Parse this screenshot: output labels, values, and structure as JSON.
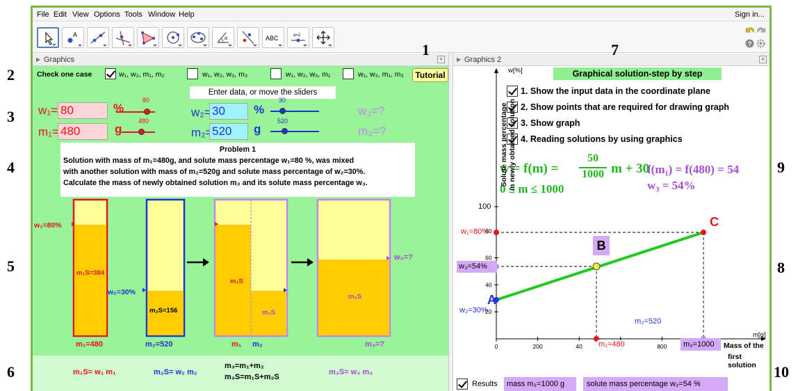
{
  "menu": [
    "File",
    "Edit",
    "View",
    "Options",
    "Tools",
    "Window",
    "Help"
  ],
  "sign_in": "Sign in...",
  "panels": {
    "graphics1": "Graphics",
    "graphics2": "Graphics 2"
  },
  "annotations": [
    "1",
    "2",
    "3",
    "4",
    "5",
    "6",
    "7",
    "8",
    "9",
    "10"
  ],
  "case_bar": {
    "label": "Check one case",
    "options": [
      "w₁, w₂, m₁, m₂",
      "w₁, w₂, w₃, m₃",
      "w₁, w₂, w₃, m₁",
      "w₁, w₃, m₁, m₃"
    ],
    "tutorial": "Tutorial"
  },
  "enter_data": "Enter data, or move the sliders",
  "inputs": {
    "w1_label": "w₁=",
    "w1_value": "80",
    "w1_unit": "%",
    "w1_slider": "80",
    "m1_label": "m₁=",
    "m1_value": "480",
    "m1_unit": "g",
    "m1_slider": "480",
    "w2_label": "w₂=",
    "w2_value": "30",
    "w2_unit": "%",
    "w2_slider": "30",
    "m2_label": "m₂=",
    "m2_value": "520",
    "m2_unit": "g",
    "m2_slider": "520",
    "w3_q": "w₃=?",
    "m3_q": "m₃=?"
  },
  "problem": {
    "title": "Problem 1",
    "line1": "Solution with mass of m₁=480g, and solute mass percentage w₁=80 %, was mixed",
    "line2": "with another solution with mass of m₂=520g and solute mass percentage of w₂=30%.",
    "line3": "Calculate the mass of newly obtained solution m₃ and its solute mass percentage w₃."
  },
  "beakers": {
    "w1": "w₁=80%",
    "m1s": "m₁S=384",
    "m1": "m₁=480",
    "w2": "w₂=30%",
    "m2s": "m₂S=156",
    "m2": "m₂=520",
    "mix_m1s": "m₁S",
    "mix_m2s": "m₂S",
    "mix_m1": "m₁",
    "mix_m2": "m₂",
    "w3": "w₃=?",
    "m3s": "m₃S",
    "m3": "m₃=?"
  },
  "formulas": {
    "f1": "m₁S= w₁ m₁",
    "f2": "m₂S= w₂ m₂",
    "f3a": "m₃=m₁+m₂",
    "f3b": "m₃S=m₁S+m₂S",
    "f4": "m₃S= w₃ m₃"
  },
  "steps": {
    "title": "Graphical solution-step by step",
    "items": [
      "1. Show the input data in the coordinate plane",
      "2. Show points that are required for drawing graph",
      "3. Show graph",
      "4. Reading solutions by using graphics"
    ]
  },
  "function_text": {
    "w_eq": "w = f(m) =",
    "num": "50",
    "den": "1000",
    "tail": "m + 30",
    "domain": "0 ≤ m ≤ 1000",
    "f_eval": "f(m₁) = f(480) = 54",
    "w3": "w₃ = 54%"
  },
  "graph": {
    "y_axis_label": "w[%]",
    "y_title_1": "Solute mass percentage",
    "y_title_2": "in newly obtained solution",
    "x_axis_label": "m[g]",
    "x_title_1": "Mass of the",
    "x_title_2": "first solution",
    "y_ticks": [
      "20",
      "40",
      "60",
      "80",
      "100"
    ],
    "x_ticks": [
      "0",
      "200",
      "40",
      "600",
      "800"
    ],
    "labels": {
      "w1": "w₁=80%",
      "w3": "w₃=54%",
      "w2": "w₂=30%",
      "m1": "m₁=480",
      "m3": "m₃=1000",
      "m2": "m₂=520",
      "A": "A",
      "B": "B",
      "C": "C"
    }
  },
  "results": {
    "label": "Results",
    "mass": "mass m₃=1000 g",
    "perc": "solute mass percentage  w₃=54 %"
  },
  "colors": {
    "green_frame": "#7ab648",
    "graphics_bg": "#99f399",
    "red": "#e8141b",
    "blue": "#1f33d6",
    "purple": "#a64bd6",
    "graph_line": "#22c922",
    "liquid": "#ffcc00",
    "solution_light": "#ffff99"
  }
}
